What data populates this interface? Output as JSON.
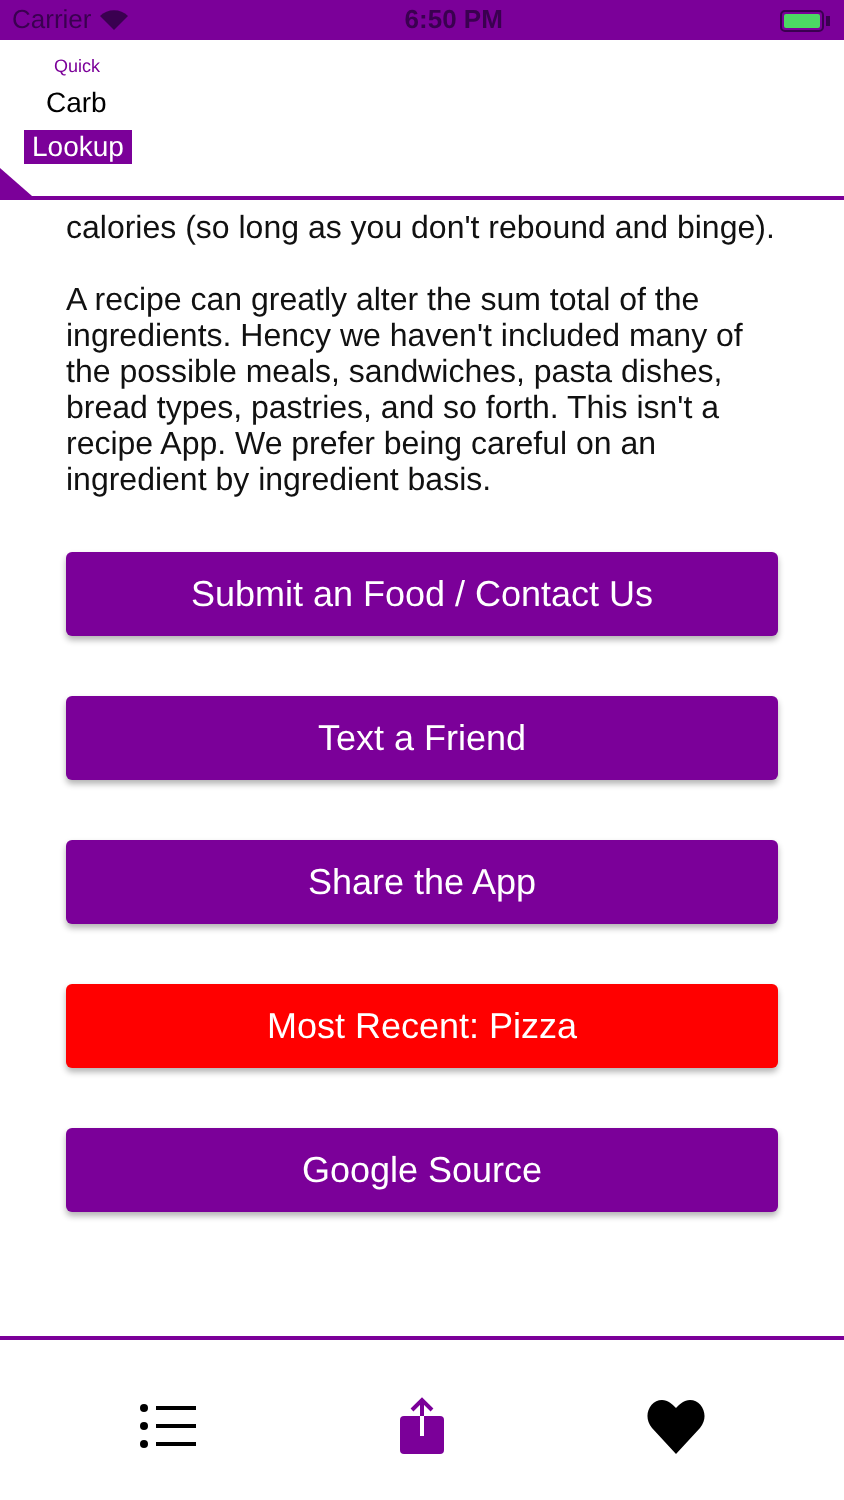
{
  "status_bar": {
    "carrier": "Carrier",
    "time": "6:50 PM"
  },
  "header": {
    "logo_small": "Quick",
    "logo_middle": "Carb",
    "logo_badge": "Lookup"
  },
  "paragraphs": [
    "calories (so long as you don't rebound and binge).",
    "A recipe can greatly alter the sum total of the ingredients. Hency we haven't included many of the possible meals, sandwiches, pasta dishes, bread types, pastries, and so forth. This isn't a recipe App. We prefer being careful on an ingredient by ingredient basis."
  ],
  "buttons": [
    {
      "label": "Submit an Food / Contact Us",
      "color": "#7b0099"
    },
    {
      "label": "Text a Friend",
      "color": "#7b0099"
    },
    {
      "label": "Share the App",
      "color": "#7b0099"
    },
    {
      "label": "Most Recent: Pizza",
      "color": "#ff0000"
    },
    {
      "label": "Google Source",
      "color": "#7b0099"
    }
  ],
  "tabs": [
    {
      "kind": "list",
      "selected": false
    },
    {
      "kind": "share",
      "selected": true
    },
    {
      "kind": "heart",
      "selected": false
    }
  ]
}
